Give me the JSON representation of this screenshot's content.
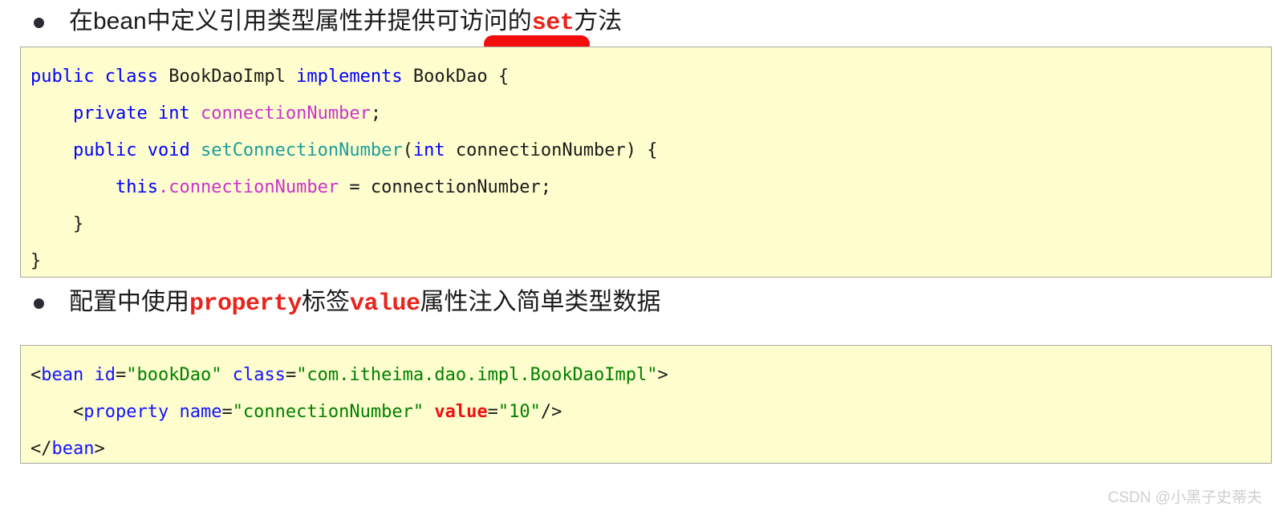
{
  "page": {
    "background_color": "#ffffff",
    "code_block_background": "#fdfdcd",
    "code_block_border": "#a9a9a0"
  },
  "bullets": [
    {
      "parts": [
        {
          "text": "在bean中定义引用类型属性并提供可访问的",
          "style": "plain"
        },
        {
          "text": "set",
          "style": "red-bold"
        },
        {
          "text": "方法",
          "style": "plain"
        }
      ],
      "plain_text": "在bean中定义引用类型属性并提供可访问的set方法"
    },
    {
      "parts": [
        {
          "text": "配置中使用",
          "style": "plain"
        },
        {
          "text": "property",
          "style": "red-bold"
        },
        {
          "text": "标签",
          "style": "plain"
        },
        {
          "text": "value",
          "style": "red-bold"
        },
        {
          "text": "属性注入简单类型数据",
          "style": "plain"
        }
      ],
      "plain_text": "配置中使用property标签value属性注入简单类型数据"
    }
  ],
  "bullet_1_text": {
    "seg_a": "在bean中定义引用类型属性并提供可访问的",
    "seg_b": "set",
    "seg_c": "方法"
  },
  "bullet_2_text": {
    "seg_a": "配置中使用",
    "seg_b": "property",
    "seg_c": "标签",
    "seg_d": "value",
    "seg_e": "属性注入简单类型数据"
  },
  "code_java": {
    "language": "java",
    "plain_text": "public class BookDaoImpl implements BookDao {\n    private int connectionNumber;\n    public void setConnectionNumber(int connectionNumber) {\n        this.connectionNumber = connectionNumber;\n    }\n}",
    "line_1": {
      "t1": "public",
      "t2": " ",
      "t3": "class",
      "t4": " BookDaoImpl ",
      "t5": "implements",
      "t6": " BookDao {"
    },
    "line_2": {
      "t1": "    ",
      "t2": "private",
      "t3": " ",
      "t4": "int",
      "t5": " ",
      "t6": "connectionNumber",
      "t7": ";"
    },
    "line_3": {
      "t1": "    ",
      "t2": "public",
      "t3": " ",
      "t4": "void",
      "t5": " ",
      "t6": "setConnectionNumber",
      "t7": "(",
      "t8": "int",
      "t9": " connectionNumber) {"
    },
    "line_4": {
      "t1": "        ",
      "t2": "this",
      "t3": ".",
      "t4": "connectionNumber",
      "t5": " = connectionNumber;"
    },
    "line_5": {
      "t1": "    }"
    },
    "line_6": {
      "t1": "}"
    }
  },
  "code_xml": {
    "language": "xml",
    "plain_text": "<bean id=\"bookDao\" class=\"com.itheima.dao.impl.BookDaoImpl\">\n    <property name=\"connectionNumber\" value=\"10\"/>\n</bean>",
    "line_1": {
      "t1": "<",
      "t2": "bean",
      "t3": " ",
      "t4": "id",
      "t5": "=",
      "t6": "\"bookDao\"",
      "t7": " ",
      "t8": "class",
      "t9": "=",
      "t10": "\"com.itheima.dao.impl.BookDaoImpl\"",
      "t11": ">"
    },
    "line_2": {
      "t1": "    <",
      "t2": "property",
      "t3": " ",
      "t4": "name",
      "t5": "=",
      "t6": "\"connectionNumber\"",
      "t7": " ",
      "t8": "value",
      "t9": "=",
      "t10": "\"10\"",
      "t11": "/>"
    },
    "line_3": {
      "t1": "</",
      "t2": "bean",
      "t3": ">"
    }
  },
  "annotation": {
    "marker_color": "#f20000",
    "marker_shape": "red-underline-scribble"
  },
  "watermark": {
    "text": "CSDN @小黑子史蒂夫",
    "color": "#cfcfcf"
  }
}
